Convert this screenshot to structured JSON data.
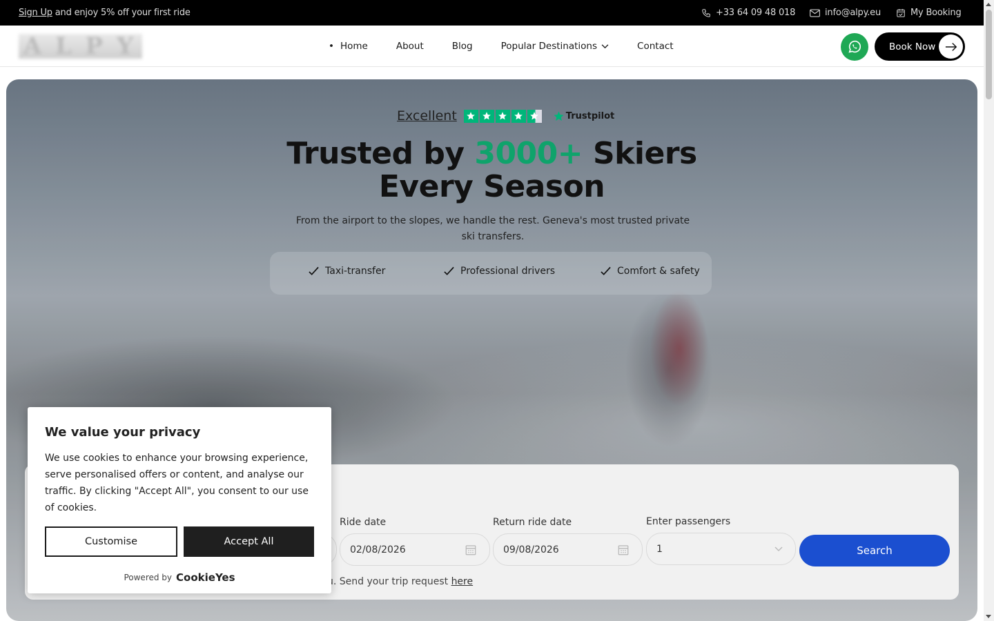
{
  "topbar": {
    "signup_link": "Sign Up",
    "promo_text": " and enjoy 5% off your first ride",
    "phone": "+33 64 09 48 018",
    "email": "info@alpy.eu",
    "my_booking": "My Booking"
  },
  "header": {
    "logo_text": "ALPY",
    "nav": [
      {
        "label": "Home"
      },
      {
        "label": "About"
      },
      {
        "label": "Blog"
      },
      {
        "label": "Popular Destinations"
      },
      {
        "label": "Contact"
      }
    ],
    "book_now": "Book Now"
  },
  "hero": {
    "rating_word": "Excellent",
    "trustpilot": "Trustpilot",
    "headline_part1": "Trusted by ",
    "headline_accent": "3000+",
    "headline_part2": " Skiers",
    "headline_line2": "Every Season",
    "subtext": "From the airport to the slopes, we handle the rest. Geneva's most trusted private ski transfers.",
    "features": [
      "Taxi-transfer",
      "Professional drivers",
      "Comfort & safety"
    ],
    "accent_color": "#0fa36b"
  },
  "booking": {
    "ride_date_label": "Ride date",
    "ride_date_value": "02/08/2026",
    "return_date_label": "Return ride date",
    "return_date_value": "09/08/2026",
    "passengers_label": "Enter passengers",
    "passengers_value": "1",
    "search_label": "Search",
    "note_text": "u. Send your trip request ",
    "note_link": "here"
  },
  "cookie": {
    "title": "We value your privacy",
    "body": "We use cookies to enhance your browsing experience, serve personalised offers or content, and analyse our traffic. By clicking \"Accept All\", you consent to our use of cookies.",
    "customise": "Customise",
    "accept_all": "Accept All",
    "powered_by": "Powered by",
    "brand": "CookieYes"
  }
}
